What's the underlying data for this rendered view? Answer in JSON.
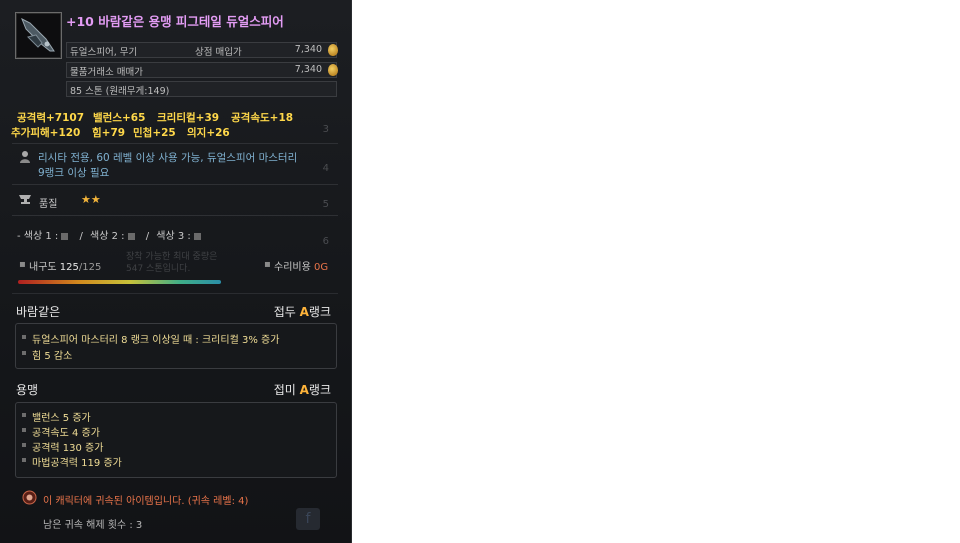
{
  "item": {
    "title": "+10 바람같은 용맹 피그테일 듀얼스피어",
    "type_label": "듀얼스피어, 무기",
    "shop_label": "상점 매입가",
    "shop_price": "7,340",
    "market_label": "물품거래소 매매가",
    "market_price": "7,340",
    "weight": "85 스톤 (원래무게:149)"
  },
  "stats": {
    "line1": [
      "공격력+7107",
      "밸런스+65",
      "크리티컬+39",
      "공격속도+18"
    ],
    "line2": [
      "추가피해+120",
      "힘+79",
      "민첩+25",
      "의지+26"
    ]
  },
  "requirement": {
    "line1": "리시타 전용, 60 레벨 이상 사용 가능, 듀얼스피어 마스터리",
    "line2": "9랭크 이상 필요"
  },
  "quality": {
    "label": "품질",
    "stars": "★★"
  },
  "colors": {
    "c1": "- 색상 1 :",
    "sep1": "/",
    "c2": "색상 2 :",
    "sep2": "/",
    "c3": "색상 3 :"
  },
  "durability": {
    "label": "내구도",
    "current": "125",
    "max": "/125",
    "repair_label": "수리비용",
    "repair_value": "0G"
  },
  "faint": {
    "line1": "장착 가능한 최대 중량은",
    "line2": "547 스톤입니다."
  },
  "enchant1": {
    "name": "바람같은",
    "rank_label": "접두",
    "rank": "A",
    "rank_suffix": "랭크",
    "lines": [
      "듀얼스피어 마스터리 8 랭크 이상일 때 : 크리티컬 3% 증가",
      "힘 5 감소"
    ]
  },
  "enchant2": {
    "name": "용맹",
    "rank_label": "접미",
    "rank": "A",
    "rank_suffix": "랭크",
    "lines": [
      "밸런스 5 증가",
      "공격속도 4 증가",
      "공격력 130 증가",
      "마법공격력 119 증가"
    ]
  },
  "bound": {
    "text": "이 캐릭터에 귀속된 아이템입니다. (귀속 레벨: 4)",
    "remaining": "남은 귀속 해제 횟수 : 3"
  },
  "background_numbers": [
    "3",
    "4",
    "5",
    "6"
  ],
  "accent_colors": {
    "title": "#e39cf4",
    "stat": "#ffd84a",
    "rank": "#ffb43a",
    "bound": "#e9744a",
    "desc": "#7fb0cf"
  }
}
